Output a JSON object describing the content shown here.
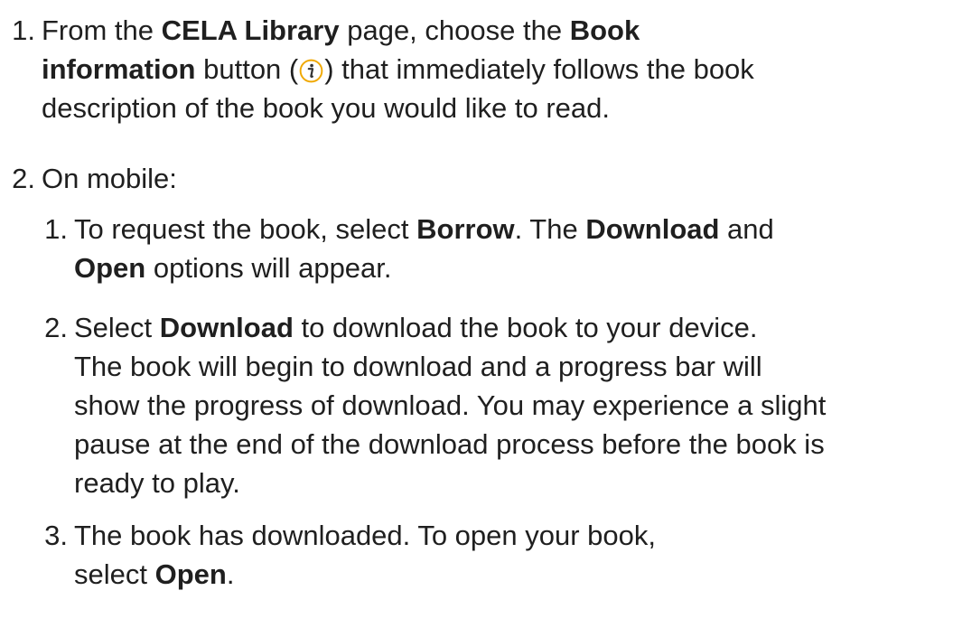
{
  "steps": [
    {
      "number": "1.",
      "lines": [
        {
          "t1": "From the ",
          "b1": "CELA Library",
          "t2": " page, choose the ",
          "b2": "Book"
        },
        {
          "b1": "information",
          "t1": " button (",
          "icon": "info-icon",
          "t2": ") that immediately follows the book"
        },
        {
          "t1": "description of the book you would like to read."
        }
      ]
    },
    {
      "number": "2.",
      "lines": [
        {
          "t1": "On mobile:"
        }
      ],
      "substeps": [
        {
          "number": "1.",
          "lines": [
            {
              "t1": "To request the book, select ",
              "b1": "Borrow",
              "t2": ". The ",
              "b2": "Download",
              "t3": " and"
            },
            {
              "b1": "Open",
              "t1": " options will appear."
            }
          ]
        },
        {
          "number": "2.",
          "lines": [
            {
              "t1": "Select ",
              "b1": "Download",
              "t2": " to download the book to your device."
            },
            {
              "t1": "The book will begin to download and a progress bar will"
            },
            {
              "t1": "show the progress of download. You may experience a slight"
            },
            {
              "t1": "pause at the end of the download process before the book is"
            },
            {
              "t1": "ready to play."
            }
          ]
        },
        {
          "number": "3.",
          "lines": [
            {
              "t1": "The book has downloaded. To open your book,"
            },
            {
              "t1": "select ",
              "b1": "Open",
              "t2": "."
            }
          ]
        }
      ]
    }
  ],
  "colors": {
    "text": "#1f1f1f",
    "icon_ring": "#f0a800",
    "icon_glyph": "#333333"
  }
}
